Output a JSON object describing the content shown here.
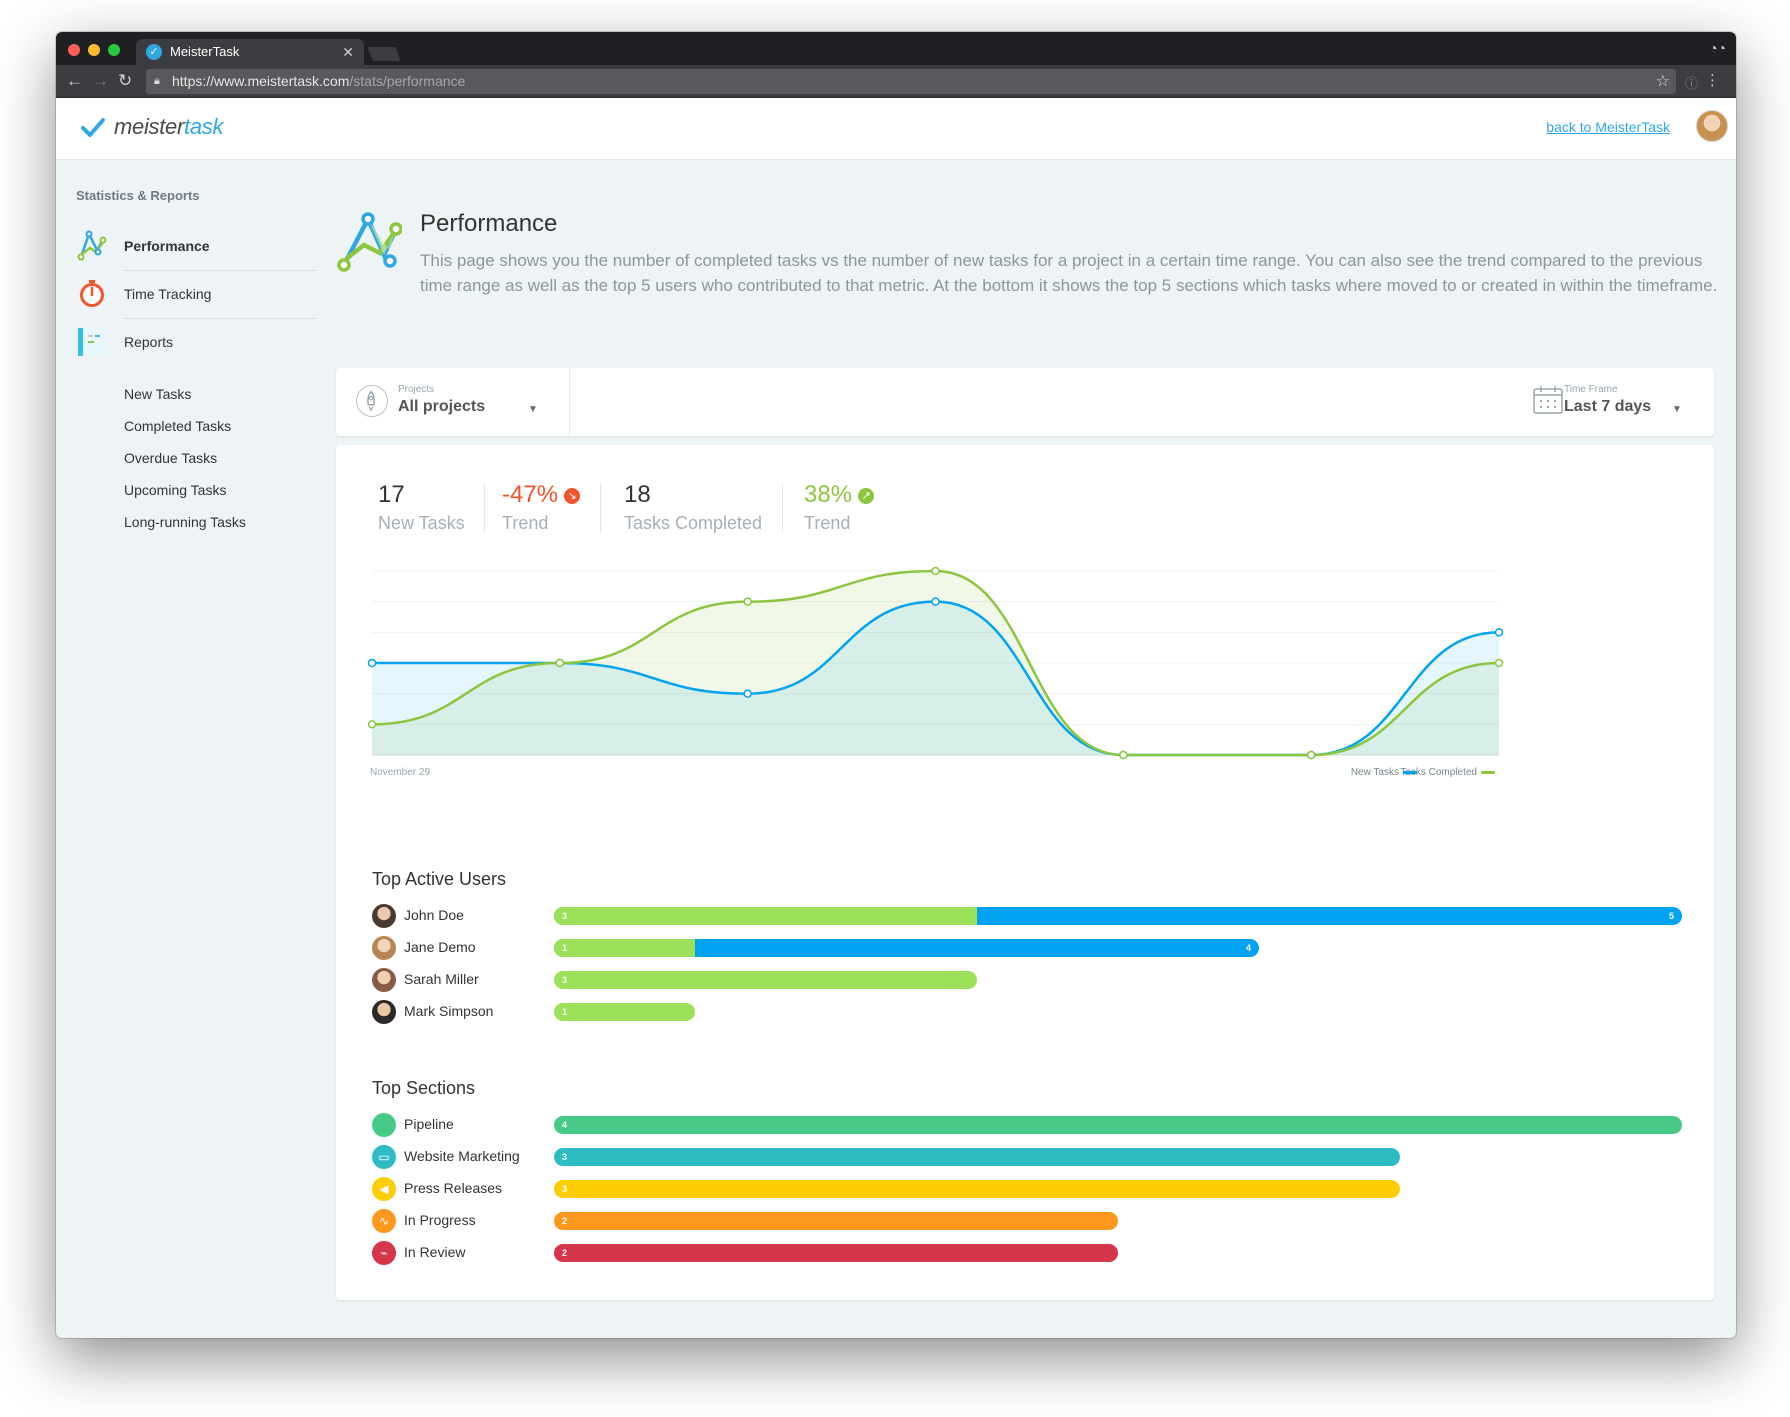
{
  "browser": {
    "tab_title": "MeisterTask",
    "url_main": "https://www.meistertask.com",
    "url_path": "/stats/performance"
  },
  "header": {
    "logo_part1": "meister",
    "logo_part2": "task",
    "back_link": "back to MeisterTask"
  },
  "sidebar": {
    "heading": "Statistics & Reports",
    "items": [
      {
        "label": "Performance",
        "icon": "performance-icon"
      },
      {
        "label": "Time Tracking",
        "icon": "stopwatch-icon"
      },
      {
        "label": "Reports",
        "icon": "reports-icon"
      }
    ],
    "reports": [
      "New Tasks",
      "Completed Tasks",
      "Overdue Tasks",
      "Upcoming Tasks",
      "Long-running Tasks"
    ]
  },
  "page": {
    "title": "Performance",
    "description": "This page shows you the number of completed tasks vs the number of new tasks for a project in a certain time range. You can also see the trend compared to the previous time range as well as the top 5 users who contributed to that metric. At the bottom it shows the top 5 sections which tasks where moved to or created in within the timeframe."
  },
  "filters": {
    "projects_label": "Projects",
    "projects_value": "All projects",
    "timeframe_label": "Time Frame",
    "timeframe_value": "Last 7 days"
  },
  "stats": {
    "new_tasks_value": "17",
    "new_tasks_label": "New Tasks",
    "new_trend_value": "-47%",
    "new_trend_label": "Trend",
    "completed_value": "18",
    "completed_label": "Tasks Completed",
    "completed_trend_value": "38%",
    "completed_trend_label": "Trend"
  },
  "colors": {
    "blue": "#00a3f1",
    "green": "#8cc63f",
    "bar_green": "#9ce15a",
    "negative": "#f2542d"
  },
  "chart_data": {
    "type": "area",
    "x": [
      0,
      1,
      2,
      3,
      4,
      5,
      6
    ],
    "x_tick_label": "November 29",
    "series": [
      {
        "name": "New Tasks",
        "color": "#00a3f1",
        "values": [
          3,
          3,
          2,
          5,
          0,
          0,
          4
        ]
      },
      {
        "name": "Tasks Completed",
        "color": "#8cc63f",
        "values": [
          1,
          3,
          5,
          6,
          0,
          0,
          3
        ]
      }
    ],
    "ylim": [
      0,
      6
    ],
    "grid": true,
    "legend": "bottom-right"
  },
  "top_users": {
    "title": "Top Active Users",
    "max": 8,
    "rows": [
      {
        "name": "John Doe",
        "completed": 3,
        "new": 5
      },
      {
        "name": "Jane Demo",
        "completed": 1,
        "new": 4
      },
      {
        "name": "Sarah Miller",
        "completed": 3,
        "new": 0
      },
      {
        "name": "Mark Simpson",
        "completed": 1,
        "new": 0
      }
    ]
  },
  "top_sections": {
    "title": "Top Sections",
    "max": 4,
    "rows": [
      {
        "name": "Pipeline",
        "value": 4,
        "color": "#47c987",
        "icon": "circle-icon"
      },
      {
        "name": "Website Marketing",
        "value": 3,
        "color": "#2ebcc3",
        "icon": "monitor-icon"
      },
      {
        "name": "Press Releases",
        "value": 3,
        "color": "#fdcd03",
        "icon": "megaphone-icon"
      },
      {
        "name": "In Progress",
        "value": 2,
        "color": "#fc981e",
        "icon": "pulse-icon"
      },
      {
        "name": "In Review",
        "value": 2,
        "color": "#d6364a",
        "icon": "heartbeat-icon"
      }
    ]
  }
}
